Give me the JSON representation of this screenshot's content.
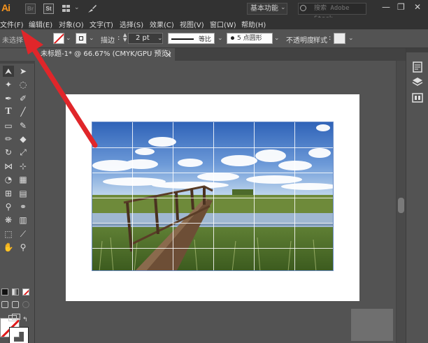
{
  "app": {
    "logo": "Ai",
    "bridge_icon": "Br",
    "stock_icon": "St"
  },
  "titlebar": {
    "workspace": "基本功能",
    "search_placeholder": "搜索 Adobe Stock"
  },
  "menu": [
    "文件(F)",
    "编辑(E)",
    "对象(O)",
    "文字(T)",
    "选择(S)",
    "效果(C)",
    "视图(V)",
    "窗口(W)",
    "帮助(H)"
  ],
  "controlbar": {
    "selection_status": "未选择",
    "stroke_label": "描边",
    "stroke_value": "2 pt",
    "profile_label": "等比",
    "brush_label": "5 点圆形",
    "opacity_label": "不透明度",
    "style_label": "样式"
  },
  "document": {
    "tab_title": "未标题-1* @ 66.67% (CMYK/GPU 预览)",
    "close_symbol": "×"
  },
  "colors": {
    "ui_dark": "#323232",
    "ui_mid": "#535353",
    "brand_orange": "#f7941d",
    "annotation_red": "#e0262a",
    "artboard": "#ffffff",
    "grid": "#ffffff"
  },
  "icons": {
    "tools": [
      "selection-tool-icon",
      "direct-selection-tool-icon",
      "magic-wand-icon",
      "lasso-icon",
      "pen-tool-icon",
      "curvature-tool-icon",
      "type-tool-icon",
      "line-segment-icon",
      "rectangle-tool-icon",
      "paintbrush-icon",
      "shaper-tool-icon",
      "eraser-icon",
      "rotate-tool-icon",
      "scale-tool-icon",
      "width-tool-icon",
      "free-transform-icon",
      "shape-builder-icon",
      "perspective-grid-icon",
      "mesh-tool-icon",
      "gradient-tool-icon",
      "eyedropper-icon",
      "blend-tool-icon",
      "symbol-sprayer-icon",
      "column-graph-icon",
      "artboard-tool-icon",
      "slice-tool-icon",
      "hand-tool-icon",
      "zoom-tool-icon"
    ],
    "dock": [
      "properties-icon",
      "layers-icon",
      "libraries-icon"
    ]
  }
}
